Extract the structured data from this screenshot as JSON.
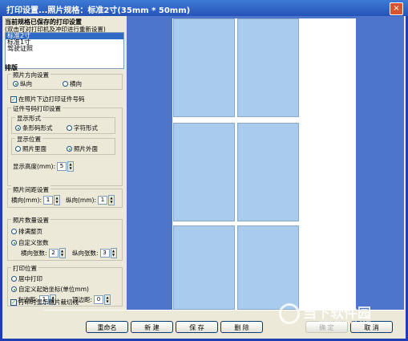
{
  "window": {
    "title": "打印设置...照片规格：标准2寸(35mm * 50mm)",
    "close": "×"
  },
  "sizes": {
    "heading": "当前规格已保存的打印设置",
    "subheading": "(双击可对打印机及冲印进行重新设置)",
    "items": [
      "标准2寸",
      "标准1寸",
      "驾驶证照"
    ],
    "selected": 0
  },
  "layout": {
    "heading": "排版",
    "orientation": {
      "caption": "照片方向设置",
      "portrait": "纵向",
      "landscape": "横向",
      "selected": "portrait"
    },
    "print_id_below": {
      "label": "在照片下边打印证件号码",
      "checked": true
    },
    "id_settings": {
      "caption": "证件号码打印设置",
      "display_format": {
        "caption": "显示形式",
        "barcode": "条形码形式",
        "text": "字符形式",
        "selected": "barcode"
      },
      "display_position": {
        "caption": "显示位置",
        "inside": "照片里面",
        "outside": "照片外面",
        "selected": "outside"
      },
      "height_label": "显示高度(mm):",
      "height_value": "5"
    },
    "spacing": {
      "caption": "照片间距设置",
      "h_label": "横向(mm):",
      "h_value": "1",
      "v_label": "纵向(mm):",
      "v_value": "1"
    },
    "count": {
      "caption": "照片数量设置",
      "fill": "排满整页",
      "custom": "自定义张数",
      "selected": "custom",
      "h_label": "横向张数:",
      "h_value": "2",
      "v_label": "纵向张数:",
      "v_value": "3"
    },
    "position": {
      "caption": "打印位置",
      "center": "居中打印",
      "custom": "自定义起始坐标(单位mm)",
      "selected": "custom",
      "left_label": "左边距:",
      "left_value": "1",
      "top_label": "顶边距:",
      "top_value": "0"
    },
    "print_border": {
      "label": "打印时显示照片裁切线",
      "checked": true
    }
  },
  "buttons": {
    "rename": "重命名",
    "new": "新 建",
    "save": "保 存",
    "delete": "删 除",
    "ok": "确 定",
    "cancel": "取 消"
  },
  "watermark": {
    "brand": "当下软件园",
    "url": "www.downxia.com"
  },
  "photo_grid": {
    "columns": 2,
    "rows": 3
  },
  "colors": {
    "preview_bg": "#4d75cc",
    "photo_fill": "#a8cbee",
    "selection": "#316ac5"
  }
}
